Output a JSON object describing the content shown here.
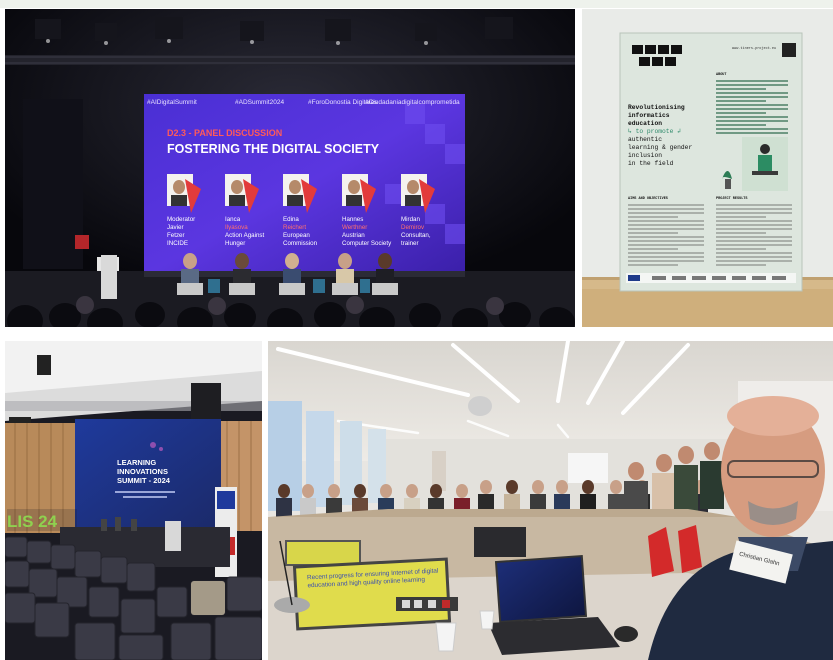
{
  "panel": {
    "session_label": "D2.3 - PANEL DISCUSSION",
    "title": "FOSTERING THE DIGITAL SOCIETY",
    "hashtags": [
      "#AIDigitalSummit",
      "#ADSummit2024",
      "#ForoDonostia Digitales",
      "#Ciudadaniadigitalcomprometida"
    ],
    "speakers": [
      {
        "line1": "Moderator",
        "line2": "Javier",
        "line3": "Fetzer",
        "line4": "INCIDE"
      },
      {
        "line1": "Ianca",
        "line2": "Ilyasova",
        "line3": "Action Against",
        "line4": "Hunger"
      },
      {
        "line1": "Edina",
        "line2": "Reichert",
        "line3": "European",
        "line4": "Commission"
      },
      {
        "line1": "Hannes",
        "line2": "Werthner",
        "line3": "Austrian",
        "line4": "Computer Society"
      },
      {
        "line1": "Mirdan",
        "line2": "Demirov",
        "line3": "Consultan,",
        "line4": "trainer"
      }
    ]
  },
  "poster": {
    "header_small": "www.tiners-project.eu",
    "title_line1": "Revolutionising",
    "title_line2": "informatics",
    "title_line3": "education",
    "title_line4": "↳ to promote ↲",
    "title_line5": "authentic",
    "title_line6": "learning & gender",
    "title_line7": "inclusion",
    "title_line8": "in the field",
    "about_heading": "ABOUT",
    "aims_heading": "AIMS AND OBJECTIVES",
    "results_heading": "PROJECT RESULTS"
  },
  "summit": {
    "title_line1": "LEARNING",
    "title_line2": "INNOVATIONS",
    "title_line3": "SUMMIT - 2024",
    "logo_text": "LIS 24"
  },
  "meeting": {
    "screen_text": "Recent progress for ensuring Internet of digital education and high quality online learning",
    "badge_text": "Christian Glahn"
  }
}
